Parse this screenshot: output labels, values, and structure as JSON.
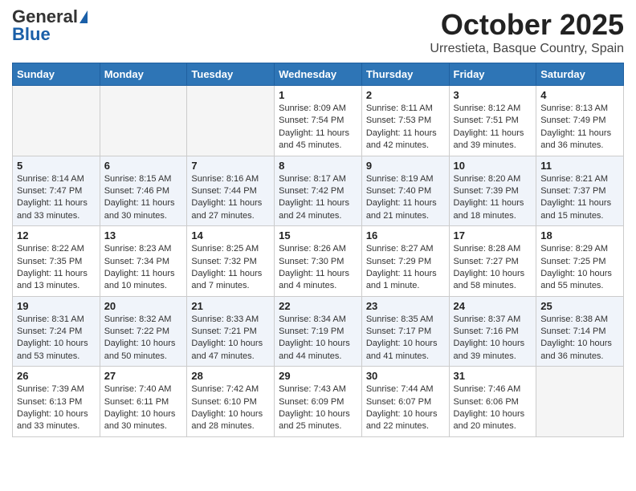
{
  "header": {
    "logo_general": "General",
    "logo_blue": "Blue",
    "title": "October 2025",
    "subtitle": "Urrestieta, Basque Country, Spain"
  },
  "columns": [
    "Sunday",
    "Monday",
    "Tuesday",
    "Wednesday",
    "Thursday",
    "Friday",
    "Saturday"
  ],
  "weeks": [
    {
      "alt": false,
      "days": [
        {
          "num": "",
          "empty": true,
          "text": ""
        },
        {
          "num": "",
          "empty": true,
          "text": ""
        },
        {
          "num": "",
          "empty": true,
          "text": ""
        },
        {
          "num": "1",
          "empty": false,
          "text": "Sunrise: 8:09 AM\nSunset: 7:54 PM\nDaylight: 11 hours\nand 45 minutes."
        },
        {
          "num": "2",
          "empty": false,
          "text": "Sunrise: 8:11 AM\nSunset: 7:53 PM\nDaylight: 11 hours\nand 42 minutes."
        },
        {
          "num": "3",
          "empty": false,
          "text": "Sunrise: 8:12 AM\nSunset: 7:51 PM\nDaylight: 11 hours\nand 39 minutes."
        },
        {
          "num": "4",
          "empty": false,
          "text": "Sunrise: 8:13 AM\nSunset: 7:49 PM\nDaylight: 11 hours\nand 36 minutes."
        }
      ]
    },
    {
      "alt": true,
      "days": [
        {
          "num": "5",
          "empty": false,
          "text": "Sunrise: 8:14 AM\nSunset: 7:47 PM\nDaylight: 11 hours\nand 33 minutes."
        },
        {
          "num": "6",
          "empty": false,
          "text": "Sunrise: 8:15 AM\nSunset: 7:46 PM\nDaylight: 11 hours\nand 30 minutes."
        },
        {
          "num": "7",
          "empty": false,
          "text": "Sunrise: 8:16 AM\nSunset: 7:44 PM\nDaylight: 11 hours\nand 27 minutes."
        },
        {
          "num": "8",
          "empty": false,
          "text": "Sunrise: 8:17 AM\nSunset: 7:42 PM\nDaylight: 11 hours\nand 24 minutes."
        },
        {
          "num": "9",
          "empty": false,
          "text": "Sunrise: 8:19 AM\nSunset: 7:40 PM\nDaylight: 11 hours\nand 21 minutes."
        },
        {
          "num": "10",
          "empty": false,
          "text": "Sunrise: 8:20 AM\nSunset: 7:39 PM\nDaylight: 11 hours\nand 18 minutes."
        },
        {
          "num": "11",
          "empty": false,
          "text": "Sunrise: 8:21 AM\nSunset: 7:37 PM\nDaylight: 11 hours\nand 15 minutes."
        }
      ]
    },
    {
      "alt": false,
      "days": [
        {
          "num": "12",
          "empty": false,
          "text": "Sunrise: 8:22 AM\nSunset: 7:35 PM\nDaylight: 11 hours\nand 13 minutes."
        },
        {
          "num": "13",
          "empty": false,
          "text": "Sunrise: 8:23 AM\nSunset: 7:34 PM\nDaylight: 11 hours\nand 10 minutes."
        },
        {
          "num": "14",
          "empty": false,
          "text": "Sunrise: 8:25 AM\nSunset: 7:32 PM\nDaylight: 11 hours\nand 7 minutes."
        },
        {
          "num": "15",
          "empty": false,
          "text": "Sunrise: 8:26 AM\nSunset: 7:30 PM\nDaylight: 11 hours\nand 4 minutes."
        },
        {
          "num": "16",
          "empty": false,
          "text": "Sunrise: 8:27 AM\nSunset: 7:29 PM\nDaylight: 11 hours\nand 1 minute."
        },
        {
          "num": "17",
          "empty": false,
          "text": "Sunrise: 8:28 AM\nSunset: 7:27 PM\nDaylight: 10 hours\nand 58 minutes."
        },
        {
          "num": "18",
          "empty": false,
          "text": "Sunrise: 8:29 AM\nSunset: 7:25 PM\nDaylight: 10 hours\nand 55 minutes."
        }
      ]
    },
    {
      "alt": true,
      "days": [
        {
          "num": "19",
          "empty": false,
          "text": "Sunrise: 8:31 AM\nSunset: 7:24 PM\nDaylight: 10 hours\nand 53 minutes."
        },
        {
          "num": "20",
          "empty": false,
          "text": "Sunrise: 8:32 AM\nSunset: 7:22 PM\nDaylight: 10 hours\nand 50 minutes."
        },
        {
          "num": "21",
          "empty": false,
          "text": "Sunrise: 8:33 AM\nSunset: 7:21 PM\nDaylight: 10 hours\nand 47 minutes."
        },
        {
          "num": "22",
          "empty": false,
          "text": "Sunrise: 8:34 AM\nSunset: 7:19 PM\nDaylight: 10 hours\nand 44 minutes."
        },
        {
          "num": "23",
          "empty": false,
          "text": "Sunrise: 8:35 AM\nSunset: 7:17 PM\nDaylight: 10 hours\nand 41 minutes."
        },
        {
          "num": "24",
          "empty": false,
          "text": "Sunrise: 8:37 AM\nSunset: 7:16 PM\nDaylight: 10 hours\nand 39 minutes."
        },
        {
          "num": "25",
          "empty": false,
          "text": "Sunrise: 8:38 AM\nSunset: 7:14 PM\nDaylight: 10 hours\nand 36 minutes."
        }
      ]
    },
    {
      "alt": false,
      "days": [
        {
          "num": "26",
          "empty": false,
          "text": "Sunrise: 7:39 AM\nSunset: 6:13 PM\nDaylight: 10 hours\nand 33 minutes."
        },
        {
          "num": "27",
          "empty": false,
          "text": "Sunrise: 7:40 AM\nSunset: 6:11 PM\nDaylight: 10 hours\nand 30 minutes."
        },
        {
          "num": "28",
          "empty": false,
          "text": "Sunrise: 7:42 AM\nSunset: 6:10 PM\nDaylight: 10 hours\nand 28 minutes."
        },
        {
          "num": "29",
          "empty": false,
          "text": "Sunrise: 7:43 AM\nSunset: 6:09 PM\nDaylight: 10 hours\nand 25 minutes."
        },
        {
          "num": "30",
          "empty": false,
          "text": "Sunrise: 7:44 AM\nSunset: 6:07 PM\nDaylight: 10 hours\nand 22 minutes."
        },
        {
          "num": "31",
          "empty": false,
          "text": "Sunrise: 7:46 AM\nSunset: 6:06 PM\nDaylight: 10 hours\nand 20 minutes."
        },
        {
          "num": "",
          "empty": true,
          "text": ""
        }
      ]
    }
  ]
}
